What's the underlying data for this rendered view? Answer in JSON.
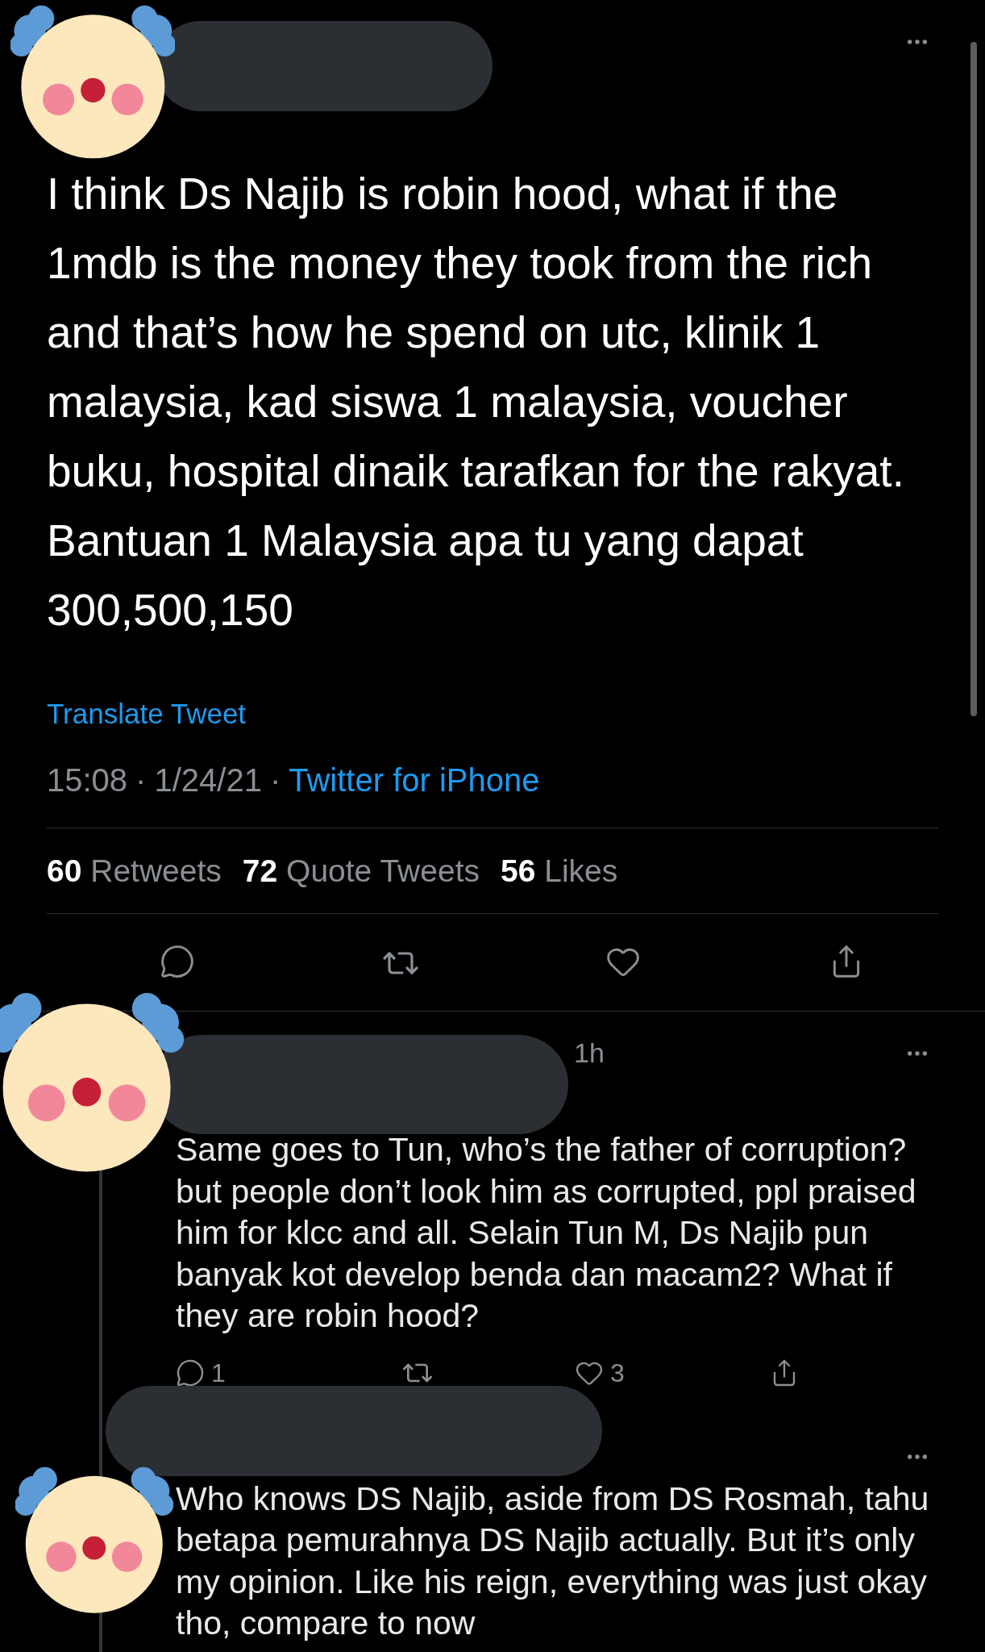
{
  "tweet": {
    "text_lines": [
      "I think Ds Najib is robin hood, what if the",
      "1mdb is the money they took from the rich",
      "and that’s how he spend on utc, klinik 1",
      "malaysia, kad siswa 1 malaysia, voucher",
      "buku, hospital dinaik tarafkan for the rakyat.",
      "Bantuan 1 Malaysia apa tu yang dapat",
      "300,500,150"
    ],
    "translate_link": "Translate Tweet",
    "time": "15:08",
    "separator": "·",
    "date": "1/24/21",
    "source": "Twitter for iPhone",
    "stats": [
      {
        "count": "60",
        "label": "Retweets"
      },
      {
        "count": "72",
        "label": "Quote Tweets"
      },
      {
        "count": "56",
        "label": "Likes"
      }
    ]
  },
  "replies": [
    {
      "time": "1h",
      "text_lines": [
        "Same goes to Tun, who’s the father of corruption?",
        "but people don’t look him as corrupted, ppl praised",
        "him for klcc and all. Selain Tun M, Ds Najib pun",
        "banyak kot develop benda dan macam2? What if",
        "they are robin hood?"
      ],
      "reply_count": "1",
      "like_count": "3"
    },
    {
      "text_lines": [
        "Who knows DS Najib, aside from DS Rosmah, tahu",
        "betapa pemurahnya DS Najib actually. But it’s only",
        "my opinion. Like his reign, everything was just okay",
        "tho, compare to now"
      ]
    }
  ]
}
